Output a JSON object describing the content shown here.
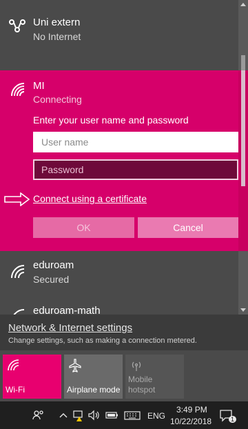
{
  "networks": {
    "uni_extern": {
      "name": "Uni extern",
      "status": "No Internet"
    },
    "mi": {
      "name": "MI",
      "status": "Connecting",
      "prompt": "Enter your user name and password",
      "username_placeholder": "User name",
      "password_placeholder": "Password",
      "cert_link": "Connect using a certificate",
      "ok_label": "OK",
      "cancel_label": "Cancel"
    },
    "eduroam": {
      "name": "eduroam",
      "status": "Secured"
    },
    "eduroam_math": {
      "name": "eduroam-math"
    }
  },
  "settings": {
    "link": "Network & Internet settings",
    "description": "Change settings, such as making a connection metered."
  },
  "quick_actions": [
    {
      "label": "Wi-Fi",
      "icon": "wifi-icon",
      "state": "on"
    },
    {
      "label": "Airplane mode",
      "icon": "airplane-icon",
      "state": "off"
    },
    {
      "label": "Mobile\nhotspot",
      "label_line1": "Mobile",
      "label_line2": "hotspot",
      "icon": "hotspot-icon",
      "state": "disabled"
    }
  ],
  "taskbar": {
    "language": "ENG",
    "time": "3:49 PM",
    "date": "10/22/2018",
    "notification_count": "1"
  },
  "colors": {
    "accent": "#d6006a",
    "panel": "#4a4a4a",
    "taskbar": "#1f1f1f"
  }
}
